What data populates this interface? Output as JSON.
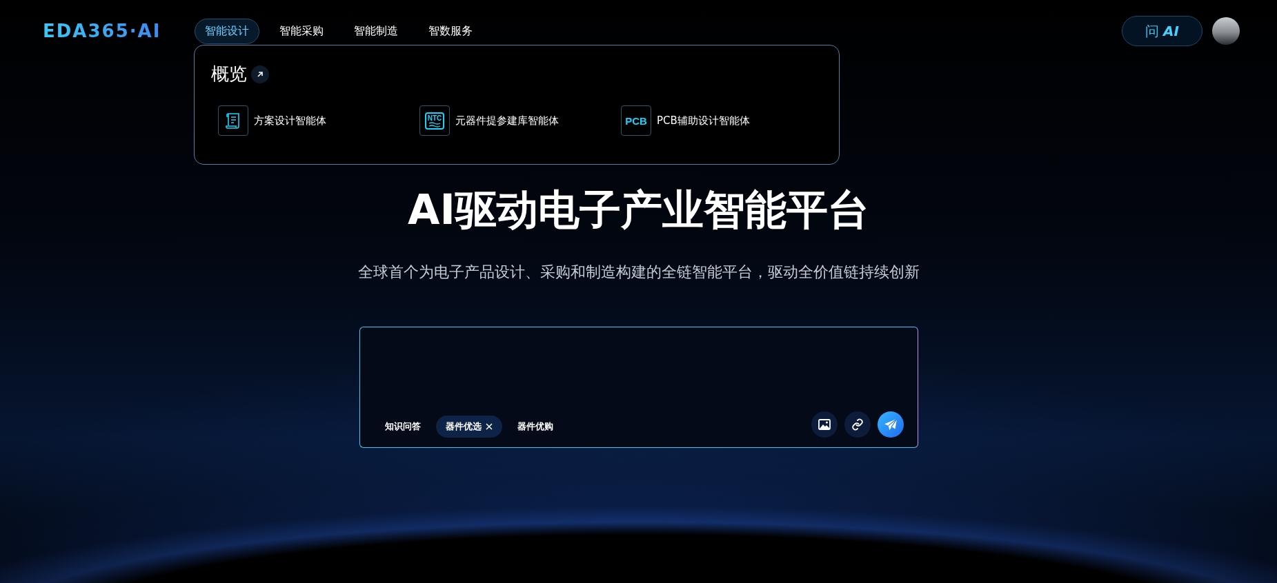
{
  "header": {
    "logo": "EDA365·AI",
    "nav": [
      {
        "label": "智能设计",
        "selected": true
      },
      {
        "label": "智能采购",
        "selected": false
      },
      {
        "label": "智能制造",
        "selected": false
      },
      {
        "label": "智数服务",
        "selected": false
      }
    ],
    "ask_button": {
      "label": "问",
      "badge": "AI"
    }
  },
  "dropdown": {
    "title": "概览",
    "items": [
      {
        "kind": "scroll",
        "label": "方案设计智能体"
      },
      {
        "kind": "badge",
        "icon_text": "NTC",
        "label": "元器件提参建库智能体"
      },
      {
        "kind": "text",
        "icon_text": "PCB",
        "label": "PCB辅助设计智能体"
      }
    ]
  },
  "hero": {
    "title": "AI驱动电子产业智能平台",
    "subtitle": "全球首个为电子产品设计、采购和制造构建的全链智能平台，驱动全价值链持续创新"
  },
  "chat": {
    "modes": [
      {
        "label": "知识问答",
        "selected": false
      },
      {
        "label": "器件优选",
        "selected": true
      },
      {
        "label": "器件优购",
        "selected": false
      }
    ]
  }
}
